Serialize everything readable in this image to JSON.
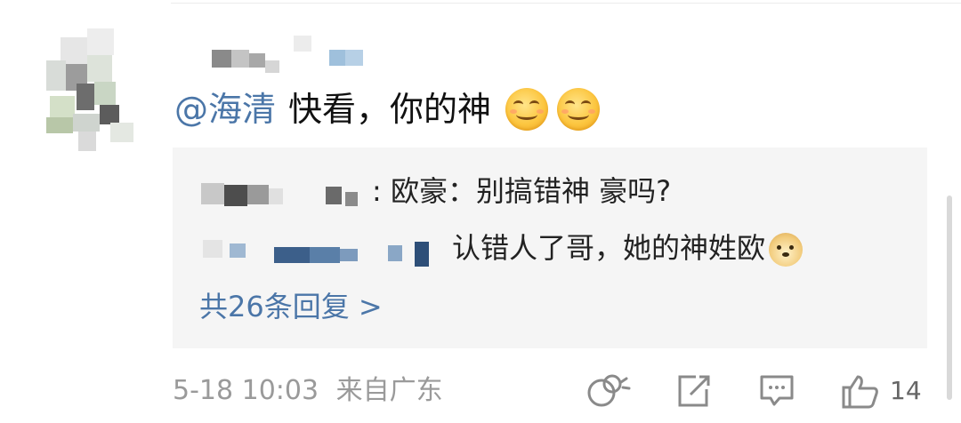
{
  "comment": {
    "mention": "@海清",
    "text": "快看，你的神",
    "emojis": [
      "smile-emoji",
      "smile-emoji"
    ]
  },
  "replies": [
    {
      "author_blurred": true,
      "text": ": 欧豪：别搞错神 豪吗?"
    },
    {
      "author_blurred": true,
      "text": "认错人了哥，她的神姓欧",
      "emoji": "doge-emoji"
    }
  ],
  "more_replies_label": "共26条回复 >",
  "meta": {
    "timestamp": "5-18 10:03",
    "location": "来自广东"
  },
  "actions": {
    "like_count": "14"
  },
  "colors": {
    "link": "#4b76a8",
    "reply_bg": "#f5f5f5",
    "meta_gray": "#9a9a9a"
  }
}
